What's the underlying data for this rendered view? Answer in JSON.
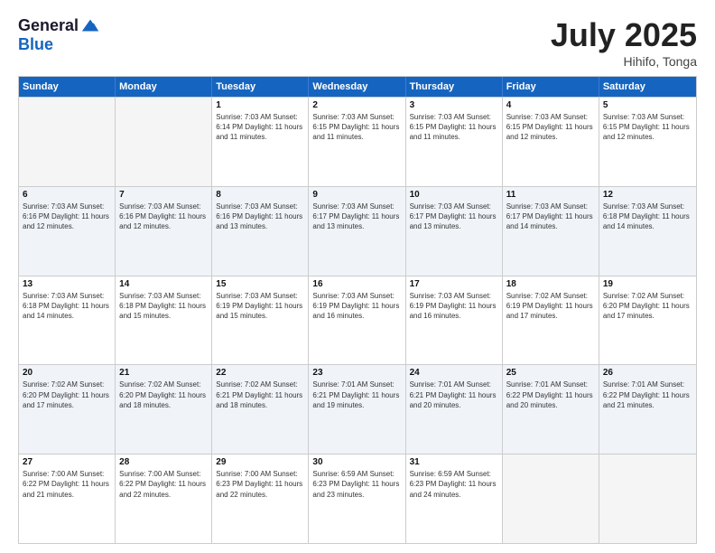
{
  "header": {
    "logo_line1": "General",
    "logo_line2": "Blue",
    "month_title": "July 2025",
    "location": "Hihifo, Tonga"
  },
  "days_of_week": [
    "Sunday",
    "Monday",
    "Tuesday",
    "Wednesday",
    "Thursday",
    "Friday",
    "Saturday"
  ],
  "weeks": [
    [
      {
        "day": "",
        "info": ""
      },
      {
        "day": "",
        "info": ""
      },
      {
        "day": "1",
        "info": "Sunrise: 7:03 AM\nSunset: 6:14 PM\nDaylight: 11 hours and 11 minutes."
      },
      {
        "day": "2",
        "info": "Sunrise: 7:03 AM\nSunset: 6:15 PM\nDaylight: 11 hours and 11 minutes."
      },
      {
        "day": "3",
        "info": "Sunrise: 7:03 AM\nSunset: 6:15 PM\nDaylight: 11 hours and 11 minutes."
      },
      {
        "day": "4",
        "info": "Sunrise: 7:03 AM\nSunset: 6:15 PM\nDaylight: 11 hours and 12 minutes."
      },
      {
        "day": "5",
        "info": "Sunrise: 7:03 AM\nSunset: 6:15 PM\nDaylight: 11 hours and 12 minutes."
      }
    ],
    [
      {
        "day": "6",
        "info": "Sunrise: 7:03 AM\nSunset: 6:16 PM\nDaylight: 11 hours and 12 minutes."
      },
      {
        "day": "7",
        "info": "Sunrise: 7:03 AM\nSunset: 6:16 PM\nDaylight: 11 hours and 12 minutes."
      },
      {
        "day": "8",
        "info": "Sunrise: 7:03 AM\nSunset: 6:16 PM\nDaylight: 11 hours and 13 minutes."
      },
      {
        "day": "9",
        "info": "Sunrise: 7:03 AM\nSunset: 6:17 PM\nDaylight: 11 hours and 13 minutes."
      },
      {
        "day": "10",
        "info": "Sunrise: 7:03 AM\nSunset: 6:17 PM\nDaylight: 11 hours and 13 minutes."
      },
      {
        "day": "11",
        "info": "Sunrise: 7:03 AM\nSunset: 6:17 PM\nDaylight: 11 hours and 14 minutes."
      },
      {
        "day": "12",
        "info": "Sunrise: 7:03 AM\nSunset: 6:18 PM\nDaylight: 11 hours and 14 minutes."
      }
    ],
    [
      {
        "day": "13",
        "info": "Sunrise: 7:03 AM\nSunset: 6:18 PM\nDaylight: 11 hours and 14 minutes."
      },
      {
        "day": "14",
        "info": "Sunrise: 7:03 AM\nSunset: 6:18 PM\nDaylight: 11 hours and 15 minutes."
      },
      {
        "day": "15",
        "info": "Sunrise: 7:03 AM\nSunset: 6:19 PM\nDaylight: 11 hours and 15 minutes."
      },
      {
        "day": "16",
        "info": "Sunrise: 7:03 AM\nSunset: 6:19 PM\nDaylight: 11 hours and 16 minutes."
      },
      {
        "day": "17",
        "info": "Sunrise: 7:03 AM\nSunset: 6:19 PM\nDaylight: 11 hours and 16 minutes."
      },
      {
        "day": "18",
        "info": "Sunrise: 7:02 AM\nSunset: 6:19 PM\nDaylight: 11 hours and 17 minutes."
      },
      {
        "day": "19",
        "info": "Sunrise: 7:02 AM\nSunset: 6:20 PM\nDaylight: 11 hours and 17 minutes."
      }
    ],
    [
      {
        "day": "20",
        "info": "Sunrise: 7:02 AM\nSunset: 6:20 PM\nDaylight: 11 hours and 17 minutes."
      },
      {
        "day": "21",
        "info": "Sunrise: 7:02 AM\nSunset: 6:20 PM\nDaylight: 11 hours and 18 minutes."
      },
      {
        "day": "22",
        "info": "Sunrise: 7:02 AM\nSunset: 6:21 PM\nDaylight: 11 hours and 18 minutes."
      },
      {
        "day": "23",
        "info": "Sunrise: 7:01 AM\nSunset: 6:21 PM\nDaylight: 11 hours and 19 minutes."
      },
      {
        "day": "24",
        "info": "Sunrise: 7:01 AM\nSunset: 6:21 PM\nDaylight: 11 hours and 20 minutes."
      },
      {
        "day": "25",
        "info": "Sunrise: 7:01 AM\nSunset: 6:22 PM\nDaylight: 11 hours and 20 minutes."
      },
      {
        "day": "26",
        "info": "Sunrise: 7:01 AM\nSunset: 6:22 PM\nDaylight: 11 hours and 21 minutes."
      }
    ],
    [
      {
        "day": "27",
        "info": "Sunrise: 7:00 AM\nSunset: 6:22 PM\nDaylight: 11 hours and 21 minutes."
      },
      {
        "day": "28",
        "info": "Sunrise: 7:00 AM\nSunset: 6:22 PM\nDaylight: 11 hours and 22 minutes."
      },
      {
        "day": "29",
        "info": "Sunrise: 7:00 AM\nSunset: 6:23 PM\nDaylight: 11 hours and 22 minutes."
      },
      {
        "day": "30",
        "info": "Sunrise: 6:59 AM\nSunset: 6:23 PM\nDaylight: 11 hours and 23 minutes."
      },
      {
        "day": "31",
        "info": "Sunrise: 6:59 AM\nSunset: 6:23 PM\nDaylight: 11 hours and 24 minutes."
      },
      {
        "day": "",
        "info": ""
      },
      {
        "day": "",
        "info": ""
      }
    ]
  ],
  "empty_cells_week1": [
    0,
    1
  ],
  "empty_cells_week5": [
    5,
    6
  ],
  "alt_rows": [
    1,
    3
  ]
}
